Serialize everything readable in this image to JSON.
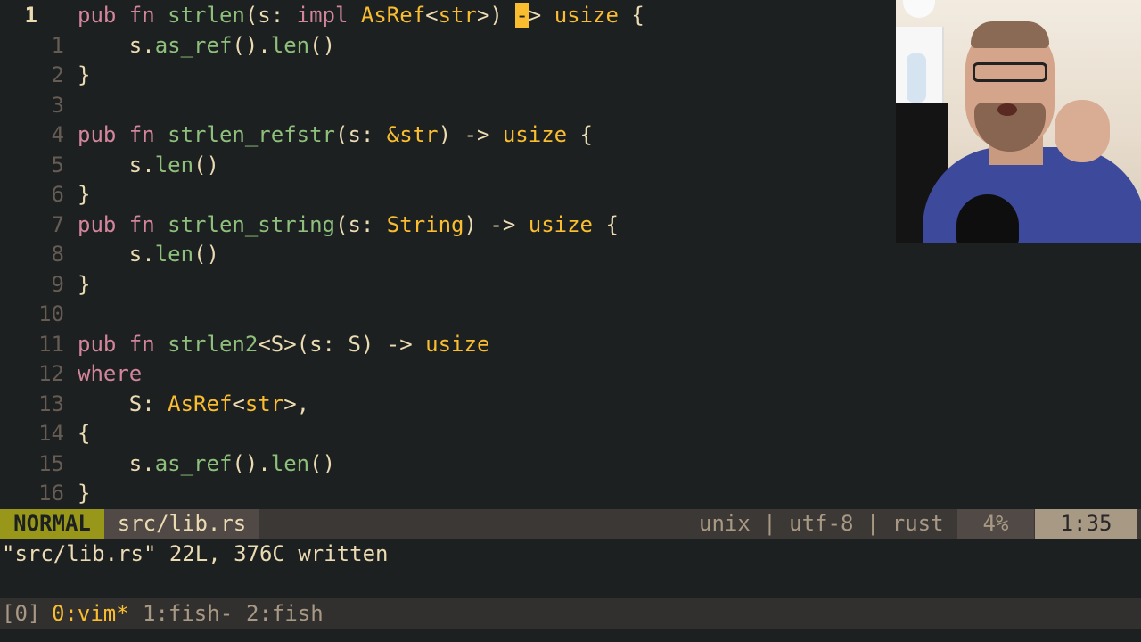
{
  "editor": {
    "lines": [
      {
        "num": "1",
        "tokens": [
          {
            "t": "pub fn ",
            "c": "kw"
          },
          {
            "t": "strlen",
            "c": "fn"
          },
          {
            "t": "(s: ",
            "c": "pl"
          },
          {
            "t": "impl ",
            "c": "kw"
          },
          {
            "t": "AsRef",
            "c": "ty"
          },
          {
            "t": "<",
            "c": "pl"
          },
          {
            "t": "str",
            "c": "ty"
          },
          {
            "t": ">) ",
            "c": "pl"
          },
          {
            "t": "-",
            "c": "cursor"
          },
          {
            "t": "> ",
            "c": "pl"
          },
          {
            "t": "usize",
            "c": "ty"
          },
          {
            "t": " {",
            "c": "pl"
          }
        ]
      },
      {
        "num": "1",
        "tokens": [
          {
            "t": "    s.",
            "c": "pl"
          },
          {
            "t": "as_ref",
            "c": "fn"
          },
          {
            "t": "().",
            "c": "pl"
          },
          {
            "t": "len",
            "c": "fn"
          },
          {
            "t": "()",
            "c": "pl"
          }
        ]
      },
      {
        "num": "2",
        "tokens": [
          {
            "t": "}",
            "c": "pl"
          }
        ]
      },
      {
        "num": "3",
        "tokens": []
      },
      {
        "num": "4",
        "tokens": [
          {
            "t": "pub fn ",
            "c": "kw"
          },
          {
            "t": "strlen_refstr",
            "c": "fn"
          },
          {
            "t": "(s: ",
            "c": "pl"
          },
          {
            "t": "&str",
            "c": "ty"
          },
          {
            "t": ") -> ",
            "c": "pl"
          },
          {
            "t": "usize",
            "c": "ty"
          },
          {
            "t": " {",
            "c": "pl"
          }
        ]
      },
      {
        "num": "5",
        "tokens": [
          {
            "t": "    s.",
            "c": "pl"
          },
          {
            "t": "len",
            "c": "fn"
          },
          {
            "t": "()",
            "c": "pl"
          }
        ]
      },
      {
        "num": "6",
        "tokens": [
          {
            "t": "}",
            "c": "pl"
          }
        ]
      },
      {
        "num": "7",
        "tokens": [
          {
            "t": "pub fn ",
            "c": "kw"
          },
          {
            "t": "strlen_string",
            "c": "fn"
          },
          {
            "t": "(s: ",
            "c": "pl"
          },
          {
            "t": "String",
            "c": "ty"
          },
          {
            "t": ") -> ",
            "c": "pl"
          },
          {
            "t": "usize",
            "c": "ty"
          },
          {
            "t": " {",
            "c": "pl"
          }
        ]
      },
      {
        "num": "8",
        "tokens": [
          {
            "t": "    s.",
            "c": "pl"
          },
          {
            "t": "len",
            "c": "fn"
          },
          {
            "t": "()",
            "c": "pl"
          }
        ]
      },
      {
        "num": "9",
        "tokens": [
          {
            "t": "}",
            "c": "pl"
          }
        ]
      },
      {
        "num": "10",
        "tokens": []
      },
      {
        "num": "11",
        "tokens": [
          {
            "t": "pub fn ",
            "c": "kw"
          },
          {
            "t": "strlen2",
            "c": "fn"
          },
          {
            "t": "<S>(s: S) -> ",
            "c": "pl"
          },
          {
            "t": "usize",
            "c": "ty"
          }
        ]
      },
      {
        "num": "12",
        "tokens": [
          {
            "t": "where",
            "c": "kw"
          }
        ]
      },
      {
        "num": "13",
        "tokens": [
          {
            "t": "    S: ",
            "c": "pl"
          },
          {
            "t": "AsRef",
            "c": "ty"
          },
          {
            "t": "<",
            "c": "pl"
          },
          {
            "t": "str",
            "c": "ty"
          },
          {
            "t": ">,",
            "c": "pl"
          }
        ]
      },
      {
        "num": "14",
        "tokens": [
          {
            "t": "{",
            "c": "pl"
          }
        ]
      },
      {
        "num": "15",
        "tokens": [
          {
            "t": "    s.",
            "c": "pl"
          },
          {
            "t": "as_ref",
            "c": "fn"
          },
          {
            "t": "().",
            "c": "pl"
          },
          {
            "t": "len",
            "c": "fn"
          },
          {
            "t": "()",
            "c": "pl"
          }
        ]
      },
      {
        "num": "16",
        "tokens": [
          {
            "t": "}",
            "c": "pl"
          }
        ]
      }
    ]
  },
  "statusline": {
    "mode": "NORMAL",
    "filename": "src/lib.rs",
    "fileinfo": "unix | utf-8 | rust",
    "percent": "4%",
    "position": "1:35"
  },
  "cmdline": {
    "message": "\"src/lib.rs\" 22L, 376C written"
  },
  "tmux": {
    "session": "[0]",
    "windows": [
      {
        "label": "0:vim*",
        "active": true
      },
      {
        "label": "1:fish-",
        "active": false
      },
      {
        "label": "2:fish",
        "active": false
      }
    ]
  },
  "colors": {
    "background": "#1d2021",
    "keyword": "#d3869b",
    "function": "#8ec07c",
    "type": "#fabd2f",
    "mode_bg": "#98971a"
  }
}
